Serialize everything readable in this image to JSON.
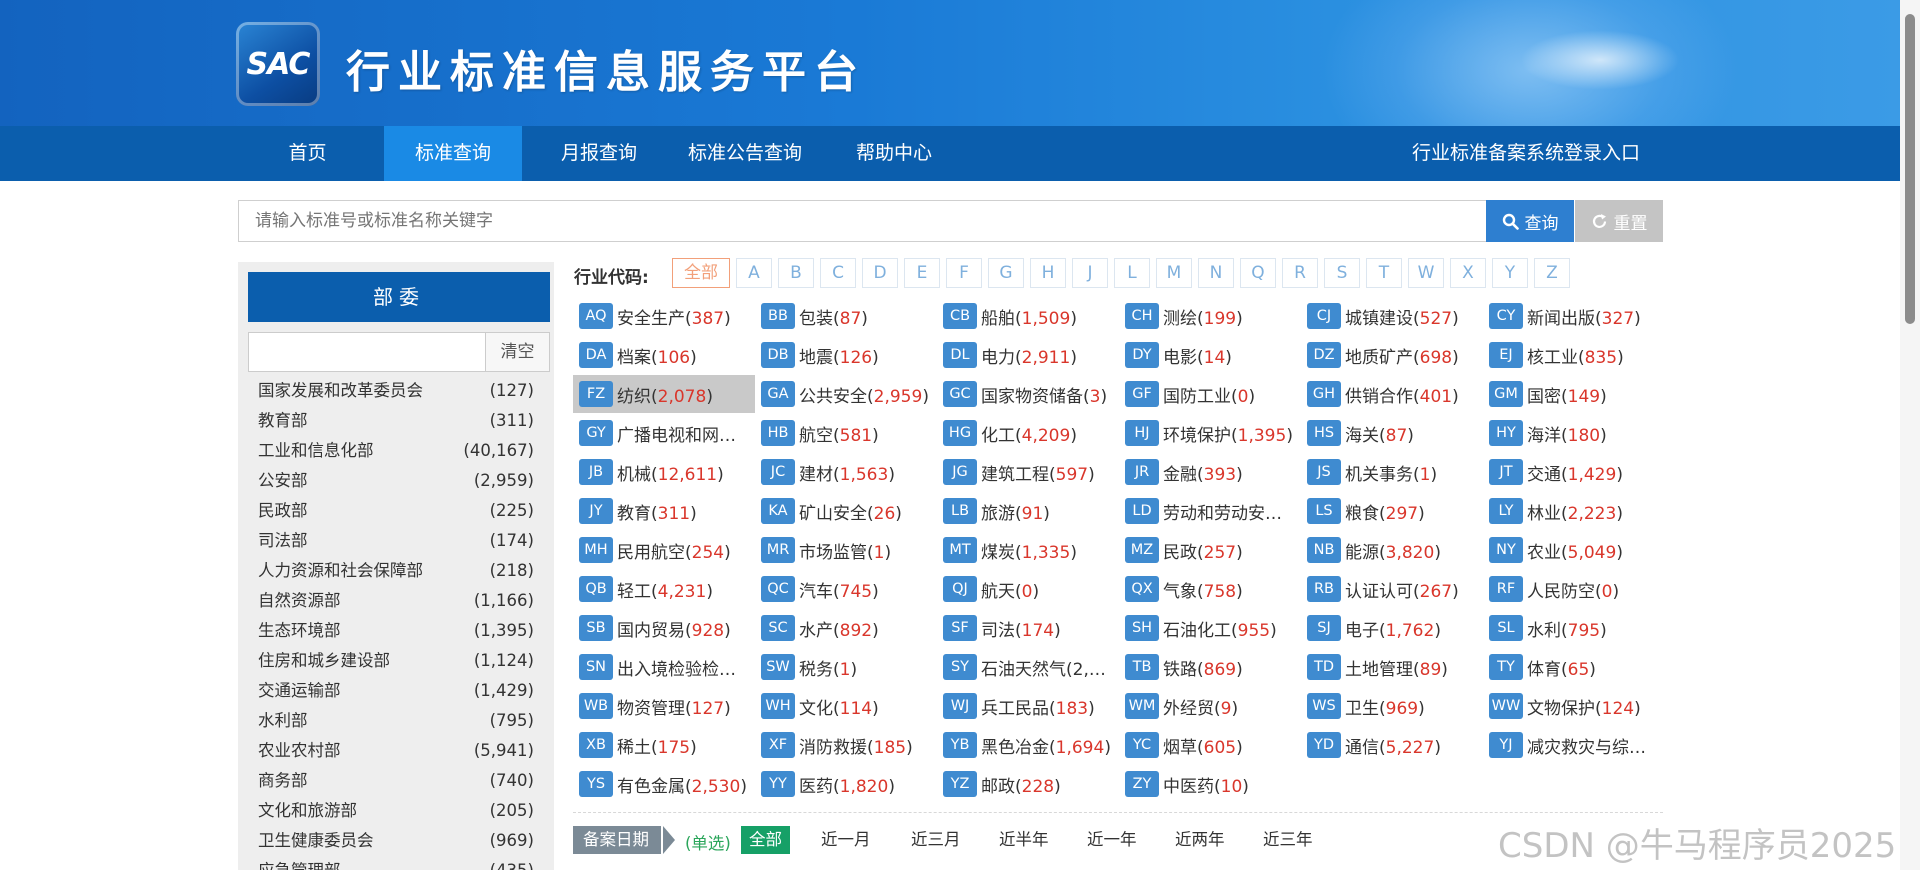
{
  "header": {
    "logo_text": "SAC",
    "site_title": "行业标准信息服务平台"
  },
  "nav": {
    "items": [
      {
        "label": "首页"
      },
      {
        "label": "标准查询",
        "active": true
      },
      {
        "label": "月报查询"
      },
      {
        "label": "标准公告查询"
      },
      {
        "label": "帮助中心"
      }
    ],
    "login_label": "行业标准备案系统登录入口"
  },
  "search": {
    "placeholder": "请输入标准号或标准名称关键字",
    "query_label": "查询",
    "reset_label": "重置",
    "query_icon": "search-icon",
    "reset_icon": "refresh-icon"
  },
  "departments": {
    "title": "部委",
    "filter_value": "",
    "clear_label": "清空",
    "items": [
      {
        "name": "国家发展和改革委员会",
        "count": "(127)"
      },
      {
        "name": "教育部",
        "count": "(311)"
      },
      {
        "name": "工业和信息化部",
        "count": "(40,167)"
      },
      {
        "name": "公安部",
        "count": "(2,959)"
      },
      {
        "name": "民政部",
        "count": "(225)"
      },
      {
        "name": "司法部",
        "count": "(174)"
      },
      {
        "name": "人力资源和社会保障部",
        "count": "(218)"
      },
      {
        "name": "自然资源部",
        "count": "(1,166)"
      },
      {
        "name": "生态环境部",
        "count": "(1,395)"
      },
      {
        "name": "住房和城乡建设部",
        "count": "(1,124)"
      },
      {
        "name": "交通运输部",
        "count": "(1,429)"
      },
      {
        "name": "水利部",
        "count": "(795)"
      },
      {
        "name": "农业农村部",
        "count": "(5,941)"
      },
      {
        "name": "商务部",
        "count": "(740)"
      },
      {
        "name": "文化和旅游部",
        "count": "(205)"
      },
      {
        "name": "卫生健康委员会",
        "count": "(969)"
      },
      {
        "name": "应急管理部",
        "count": "(435)"
      }
    ]
  },
  "industry": {
    "label": "行业代码:",
    "letters": [
      "全部",
      "A",
      "B",
      "C",
      "D",
      "E",
      "F",
      "G",
      "H",
      "J",
      "L",
      "M",
      "N",
      "Q",
      "R",
      "S",
      "T",
      "W",
      "X",
      "Y",
      "Z"
    ],
    "selected_letter": "全部",
    "codes": [
      {
        "code": "AQ",
        "name": "安全生产",
        "count": "387"
      },
      {
        "code": "BB",
        "name": "包装",
        "count": "87"
      },
      {
        "code": "CB",
        "name": "船舶",
        "count": "1,509"
      },
      {
        "code": "CH",
        "name": "测绘",
        "count": "199"
      },
      {
        "code": "CJ",
        "name": "城镇建设",
        "count": "527"
      },
      {
        "code": "CY",
        "name": "新闻出版",
        "count": "327"
      },
      {
        "code": "DA",
        "name": "档案",
        "count": "106"
      },
      {
        "code": "DB",
        "name": "地震",
        "count": "126"
      },
      {
        "code": "DL",
        "name": "电力",
        "count": "2,911"
      },
      {
        "code": "DY",
        "name": "电影",
        "count": "14"
      },
      {
        "code": "DZ",
        "name": "地质矿产",
        "count": "698"
      },
      {
        "code": "EJ",
        "name": "核工业",
        "count": "835"
      },
      {
        "code": "FZ",
        "name": "纺织",
        "count": "2,078",
        "highlighted": true
      },
      {
        "code": "GA",
        "name": "公共安全",
        "count": "2,959"
      },
      {
        "code": "GC",
        "name": "国家物资储备",
        "count": "3"
      },
      {
        "code": "GF",
        "name": "国防工业",
        "count": "0"
      },
      {
        "code": "GH",
        "name": "供销合作",
        "count": "401"
      },
      {
        "code": "GM",
        "name": "国密",
        "count": "149"
      },
      {
        "code": "GY",
        "name": "广播电视和网…",
        "count": ""
      },
      {
        "code": "HB",
        "name": "航空",
        "count": "581"
      },
      {
        "code": "HG",
        "name": "化工",
        "count": "4,209"
      },
      {
        "code": "HJ",
        "name": "环境保护",
        "count": "1,395"
      },
      {
        "code": "HS",
        "name": "海关",
        "count": "87"
      },
      {
        "code": "HY",
        "name": "海洋",
        "count": "180"
      },
      {
        "code": "JB",
        "name": "机械",
        "count": "12,611"
      },
      {
        "code": "JC",
        "name": "建材",
        "count": "1,563"
      },
      {
        "code": "JG",
        "name": "建筑工程",
        "count": "597"
      },
      {
        "code": "JR",
        "name": "金融",
        "count": "393"
      },
      {
        "code": "JS",
        "name": "机关事务",
        "count": "1"
      },
      {
        "code": "JT",
        "name": "交通",
        "count": "1,429"
      },
      {
        "code": "JY",
        "name": "教育",
        "count": "311"
      },
      {
        "code": "KA",
        "name": "矿山安全",
        "count": "26"
      },
      {
        "code": "LB",
        "name": "旅游",
        "count": "91"
      },
      {
        "code": "LD",
        "name": "劳动和劳动安…",
        "count": ""
      },
      {
        "code": "LS",
        "name": "粮食",
        "count": "297"
      },
      {
        "code": "LY",
        "name": "林业",
        "count": "2,223"
      },
      {
        "code": "MH",
        "name": "民用航空",
        "count": "254"
      },
      {
        "code": "MR",
        "name": "市场监管",
        "count": "1"
      },
      {
        "code": "MT",
        "name": "煤炭",
        "count": "1,335"
      },
      {
        "code": "MZ",
        "name": "民政",
        "count": "257"
      },
      {
        "code": "NB",
        "name": "能源",
        "count": "3,820"
      },
      {
        "code": "NY",
        "name": "农业",
        "count": "5,049"
      },
      {
        "code": "QB",
        "name": "轻工",
        "count": "4,231"
      },
      {
        "code": "QC",
        "name": "汽车",
        "count": "745"
      },
      {
        "code": "QJ",
        "name": "航天",
        "count": "0"
      },
      {
        "code": "QX",
        "name": "气象",
        "count": "758"
      },
      {
        "code": "RB",
        "name": "认证认可",
        "count": "267"
      },
      {
        "code": "RF",
        "name": "人民防空",
        "count": "0"
      },
      {
        "code": "SB",
        "name": "国内贸易",
        "count": "928"
      },
      {
        "code": "SC",
        "name": "水产",
        "count": "892"
      },
      {
        "code": "SF",
        "name": "司法",
        "count": "174"
      },
      {
        "code": "SH",
        "name": "石油化工",
        "count": "955"
      },
      {
        "code": "SJ",
        "name": "电子",
        "count": "1,762"
      },
      {
        "code": "SL",
        "name": "水利",
        "count": "795"
      },
      {
        "code": "SN",
        "name": "出入境检验检…",
        "count": ""
      },
      {
        "code": "SW",
        "name": "税务",
        "count": "1"
      },
      {
        "code": "SY",
        "name": "石油天然气(2,6…",
        "count": ""
      },
      {
        "code": "TB",
        "name": "铁路",
        "count": "869"
      },
      {
        "code": "TD",
        "name": "土地管理",
        "count": "89"
      },
      {
        "code": "TY",
        "name": "体育",
        "count": "65"
      },
      {
        "code": "WB",
        "name": "物资管理",
        "count": "127"
      },
      {
        "code": "WH",
        "name": "文化",
        "count": "114"
      },
      {
        "code": "WJ",
        "name": "兵工民品",
        "count": "183"
      },
      {
        "code": "WM",
        "name": "外经贸",
        "count": "9"
      },
      {
        "code": "WS",
        "name": "卫生",
        "count": "969"
      },
      {
        "code": "WW",
        "name": "文物保护",
        "count": "124"
      },
      {
        "code": "XB",
        "name": "稀土",
        "count": "175"
      },
      {
        "code": "XF",
        "name": "消防救援",
        "count": "185"
      },
      {
        "code": "YB",
        "name": "黑色冶金",
        "count": "1,694"
      },
      {
        "code": "YC",
        "name": "烟草",
        "count": "605"
      },
      {
        "code": "YD",
        "name": "通信",
        "count": "5,227"
      },
      {
        "code": "YJ",
        "name": "减灾救灾与综…",
        "count": ""
      },
      {
        "code": "YS",
        "name": "有色金属",
        "count": "2,530"
      },
      {
        "code": "YY",
        "name": "医药",
        "count": "1,820"
      },
      {
        "code": "YZ",
        "name": "邮政",
        "count": "228"
      },
      {
        "code": "ZY",
        "name": "中医药",
        "count": "10"
      }
    ]
  },
  "date_filter": {
    "label": "备案日期",
    "mode": "(单选)",
    "options": [
      "全部",
      "近一月",
      "近三月",
      "近半年",
      "近一年",
      "近两年",
      "近三年"
    ],
    "selected": "全部"
  },
  "watermark": "CSDN @牛马程序员2025"
}
